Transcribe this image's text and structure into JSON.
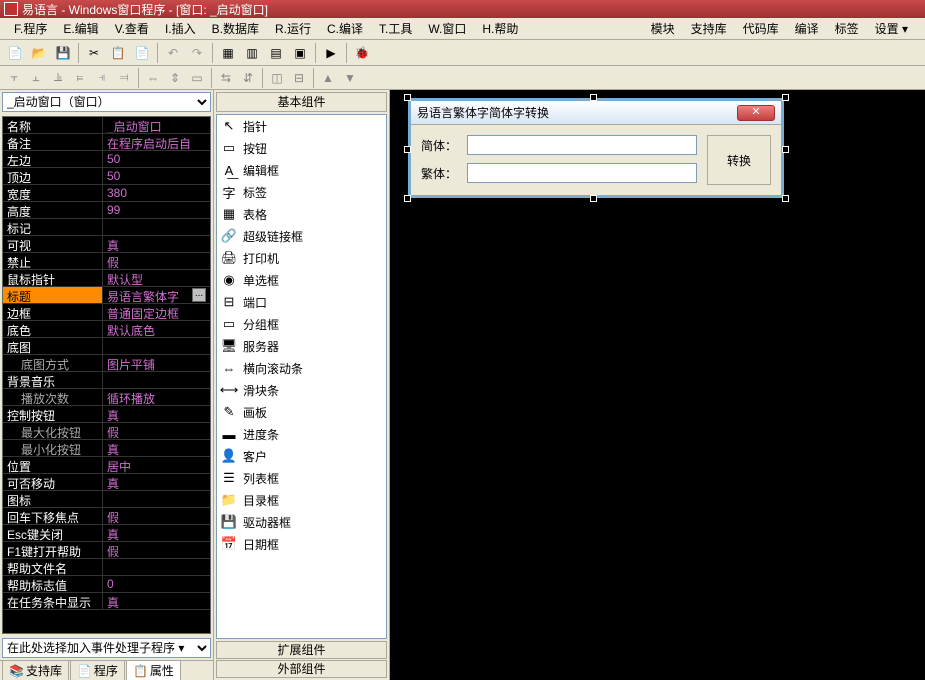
{
  "title": "易语言 - Windows窗口程序 - [窗口: _启动窗口]",
  "menu": {
    "items": [
      "F.程序",
      "E.编辑",
      "V.查看",
      "I.插入",
      "B.数据库",
      "R.运行",
      "C.编译",
      "T.工具",
      "W.窗口",
      "H.帮助"
    ],
    "right": [
      "模块",
      "支持库",
      "代码库",
      "编译",
      "标签",
      "设置 ▾"
    ]
  },
  "prop_combo": "_启动窗口（窗口）",
  "properties": [
    {
      "name": "名称",
      "value": "_启动窗口"
    },
    {
      "name": "备注",
      "value": "在程序启动后自"
    },
    {
      "name": "左边",
      "value": "50"
    },
    {
      "name": "顶边",
      "value": "50"
    },
    {
      "name": "宽度",
      "value": "380"
    },
    {
      "name": "高度",
      "value": "99"
    },
    {
      "name": "标记",
      "value": ""
    },
    {
      "name": "可视",
      "value": "真"
    },
    {
      "name": "禁止",
      "value": "假"
    },
    {
      "name": "鼠标指针",
      "value": "默认型"
    },
    {
      "name": "标题",
      "value": "易语言繁体字",
      "sel": true,
      "dots": true
    },
    {
      "name": "边框",
      "value": "普通固定边框"
    },
    {
      "name": "底色",
      "value": "默认底色"
    },
    {
      "name": "底图",
      "value": ""
    },
    {
      "name": "底图方式",
      "value": "图片平铺",
      "indent": true
    },
    {
      "name": "背景音乐",
      "value": ""
    },
    {
      "name": "播放次数",
      "value": "循环播放",
      "indent": true
    },
    {
      "name": "控制按钮",
      "value": "真"
    },
    {
      "name": "最大化按钮",
      "value": "假",
      "indent": true
    },
    {
      "name": "最小化按钮",
      "value": "真",
      "indent": true
    },
    {
      "name": "位置",
      "value": "居中"
    },
    {
      "name": "可否移动",
      "value": "真"
    },
    {
      "name": "图标",
      "value": ""
    },
    {
      "name": "回车下移焦点",
      "value": "假"
    },
    {
      "name": "Esc键关闭",
      "value": "真"
    },
    {
      "name": "F1键打开帮助",
      "value": "假"
    },
    {
      "name": "帮助文件名",
      "value": ""
    },
    {
      "name": "帮助标志值",
      "value": "0"
    },
    {
      "name": "在任务条中显示",
      "value": "真"
    }
  ],
  "event_combo": "在此处选择加入事件处理子程序 ▾",
  "tabs": [
    {
      "label": "支持库",
      "icon": "📚"
    },
    {
      "label": "程序",
      "icon": "📄"
    },
    {
      "label": "属性",
      "icon": "📋",
      "active": true
    }
  ],
  "component_header": "基本组件",
  "components": [
    {
      "icon": "↖",
      "label": "指针"
    },
    {
      "icon": "▭",
      "label": "按钮"
    },
    {
      "icon": "A͟",
      "label": "编辑框"
    },
    {
      "icon": "字",
      "label": "标签"
    },
    {
      "icon": "▦",
      "label": "表格"
    },
    {
      "icon": "🔗",
      "label": "超级链接框"
    },
    {
      "icon": "🖨",
      "label": "打印机"
    },
    {
      "icon": "◉",
      "label": "单选框"
    },
    {
      "icon": "⊟",
      "label": "端口"
    },
    {
      "icon": "▭",
      "label": "分组框"
    },
    {
      "icon": "🖥",
      "label": "服务器"
    },
    {
      "icon": "⇔",
      "label": "横向滚动条"
    },
    {
      "icon": "⟷",
      "label": "滑块条"
    },
    {
      "icon": "✎",
      "label": "画板"
    },
    {
      "icon": "▬",
      "label": "进度条"
    },
    {
      "icon": "👤",
      "label": "客户"
    },
    {
      "icon": "☰",
      "label": "列表框"
    },
    {
      "icon": "📁",
      "label": "目录框"
    },
    {
      "icon": "💾",
      "label": "驱动器框"
    },
    {
      "icon": "📅",
      "label": "日期框"
    }
  ],
  "component_footer": [
    "扩展组件",
    "外部组件"
  ],
  "form": {
    "title": "易语言繁体字简体字转换",
    "label1": "简体：",
    "label2": "繁体：",
    "button": "转换",
    "input1": "",
    "input2": ""
  }
}
